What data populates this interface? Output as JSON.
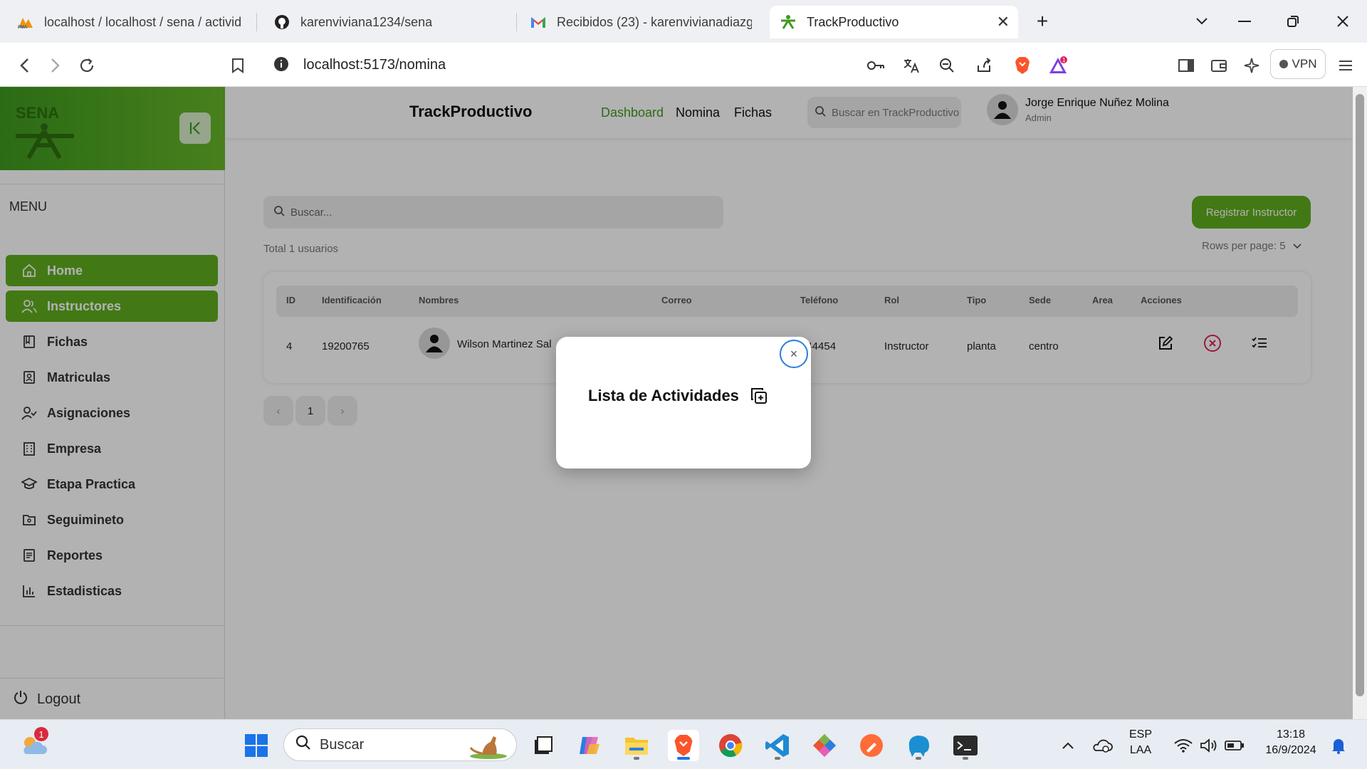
{
  "browser": {
    "tabs": [
      {
        "label": "localhost / localhost / sena / activid"
      },
      {
        "label": "karenviviana1234/sena"
      },
      {
        "label": "Recibidos (23) - karenvivianadiazgu"
      },
      {
        "label": "TrackProductivo"
      }
    ],
    "url": "localhost:5173/nomina",
    "vpn_label": "VPN",
    "notification_count": "1"
  },
  "sidebar": {
    "logo_text": "SENA",
    "menu_title": "MENU",
    "items": [
      {
        "label": "Home",
        "icon": "home-icon"
      },
      {
        "label": "Instructores",
        "icon": "users-icon"
      },
      {
        "label": "Fichas",
        "icon": "book-icon"
      },
      {
        "label": "Matriculas",
        "icon": "id-card-icon"
      },
      {
        "label": "Asignaciones",
        "icon": "user-check-icon"
      },
      {
        "label": "Empresa",
        "icon": "building-icon"
      },
      {
        "label": "Etapa Practica",
        "icon": "graduation-cap-icon"
      },
      {
        "label": "Seguimineto",
        "icon": "folder-icon"
      },
      {
        "label": "Reportes",
        "icon": "report-icon"
      },
      {
        "label": "Estadisticas",
        "icon": "bar-chart-icon"
      }
    ],
    "logout_label": "Logout"
  },
  "topbar": {
    "brand": "TrackProductivo",
    "nav": [
      "Dashboard",
      "Nomina",
      "Fichas"
    ],
    "search_placeholder": "Buscar en TrackProductivo",
    "user_name": "Jorge Enrique Nuñez Molina",
    "user_role": "Admin"
  },
  "main": {
    "search_placeholder": "Buscar...",
    "register_button": "Registrar Instructor",
    "total_text": "Total 1 usuarios",
    "rows_per_page": "Rows per page: 5",
    "columns": [
      "ID",
      "Identificación",
      "Nombres",
      "Correo",
      "Teléfono",
      "Rol",
      "Tipo",
      "Sede",
      "Area",
      "Acciones"
    ],
    "rows": [
      {
        "id": "4",
        "identificacion": "19200765",
        "nombres": "Wilson Martinez Sal",
        "telefono": "544454",
        "rol": "Instructor",
        "tipo": "planta",
        "sede": "centro",
        "area": ""
      }
    ],
    "pagination": {
      "prev": "‹",
      "current": "1",
      "next": "›"
    }
  },
  "modal": {
    "title": "Lista de Actividades",
    "close_label": "×"
  },
  "taskbar": {
    "search_label": "Buscar",
    "weather_badge": "1",
    "lang_line1": "ESP",
    "lang_line2": "LAA",
    "time": "13:18",
    "date": "16/9/2024"
  },
  "colors": {
    "accent_green": "#5fae1f",
    "modal_close_ring": "#2a7de1",
    "delete_red": "#d6285a"
  }
}
